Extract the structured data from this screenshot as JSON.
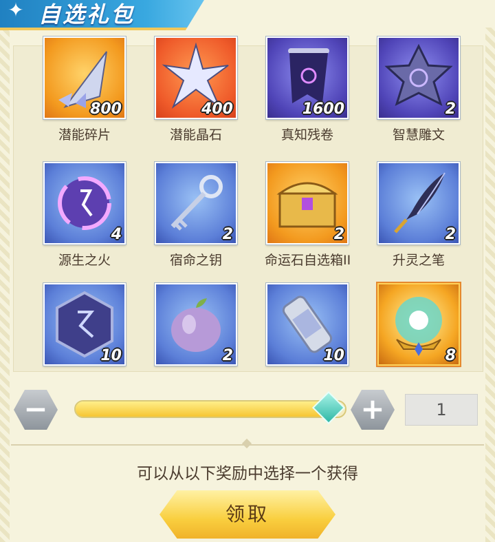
{
  "title": "自选礼包",
  "items": [
    {
      "name": "潜能碎片",
      "count": "800",
      "icon": "shard-icon",
      "bg": "orange"
    },
    {
      "name": "潜能晶石",
      "count": "400",
      "icon": "crystal-star-icon",
      "bg": "red"
    },
    {
      "name": "真知残卷",
      "count": "1600",
      "icon": "scroll-banner-icon",
      "bg": "purple"
    },
    {
      "name": "智慧雕文",
      "count": "2",
      "icon": "rune-star-icon",
      "bg": "purple"
    },
    {
      "name": "源生之火",
      "count": "4",
      "icon": "rune-orb-icon",
      "bg": "blue"
    },
    {
      "name": "宿命之钥",
      "count": "2",
      "icon": "key-icon",
      "bg": "blue"
    },
    {
      "name": "命运石自选箱II",
      "count": "2",
      "icon": "treasure-chest-icon",
      "bg": "orange"
    },
    {
      "name": "升灵之笔",
      "count": "2",
      "icon": "quill-pen-icon",
      "bg": "blue"
    },
    {
      "name": "",
      "count": "10",
      "icon": "rune-stone-icon",
      "bg": "blue"
    },
    {
      "name": "",
      "count": "2",
      "icon": "fruit-icon",
      "bg": "blue"
    },
    {
      "name": "",
      "count": "10",
      "icon": "canister-icon",
      "bg": "blue"
    },
    {
      "name": "",
      "count": "8",
      "icon": "crystal-ball-icon",
      "bg": "gold"
    }
  ],
  "quantity": {
    "value": "1",
    "slider_fraction": 0.94,
    "minus_label": "−",
    "plus_label": "+"
  },
  "hint": "可以从以下奖励中选择一个获得",
  "claim_label": "领取"
}
